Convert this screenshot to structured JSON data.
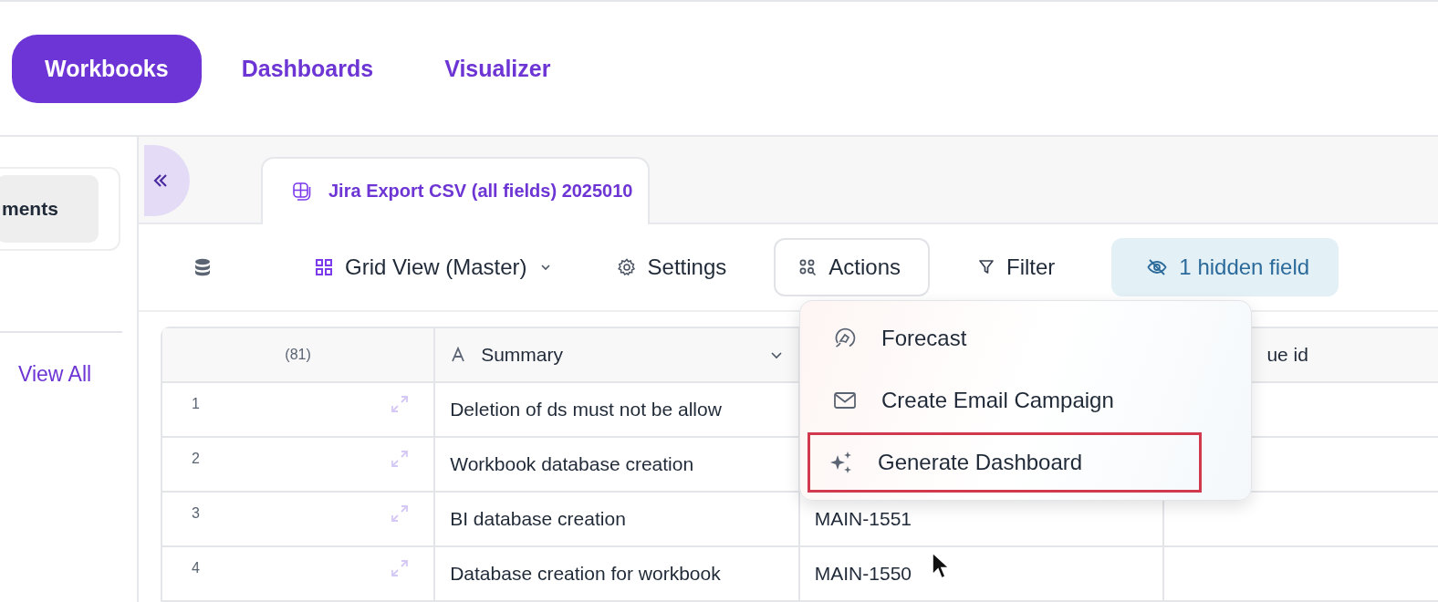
{
  "nav_tabs": [
    {
      "label": "Workbooks",
      "selected": true
    },
    {
      "label": "Dashboards",
      "selected": false
    },
    {
      "label": "Visualizer",
      "selected": false
    }
  ],
  "sidebar": {
    "button": "ments",
    "link": "View All"
  },
  "sheet_tabs": [
    {
      "label": "Jira Export CSV (all fields) 2025010",
      "selected": true
    }
  ],
  "toolbar": [
    {
      "kind": "database"
    },
    {
      "kind": "view",
      "label": "Grid View (Master)"
    },
    {
      "kind": "settings",
      "label": "Settings"
    },
    {
      "kind": "actions",
      "label": "Actions",
      "open": true
    },
    {
      "kind": "filter",
      "label": "Filter"
    },
    {
      "kind": "hidden",
      "label": "1 hidden field"
    }
  ],
  "actions_menu": [
    {
      "kind": "forecast",
      "label": "Forecast",
      "highlighted": false
    },
    {
      "kind": "email",
      "label": "Create Email Campaign",
      "highlighted": false
    },
    {
      "kind": "generate",
      "label": "Generate Dashboard",
      "highlighted": true
    }
  ],
  "table": {
    "count": "(81)",
    "columns": [
      {
        "label": "Summary",
        "kind": "text"
      },
      {
        "kind": "blank"
      },
      {
        "label": "ue id",
        "kind": "partial"
      }
    ],
    "rows": [
      {
        "number": "1",
        "cells": [
          "Deletion of ds must not be allow"
        ]
      },
      {
        "number": "2",
        "cells": [
          "Workbook database creation"
        ]
      },
      {
        "number": "3",
        "cells": [
          "BI database creation",
          "MAIN-1551"
        ]
      },
      {
        "number": "4",
        "cells": [
          "Database creation for workbook",
          "MAIN-1550"
        ]
      }
    ]
  }
}
